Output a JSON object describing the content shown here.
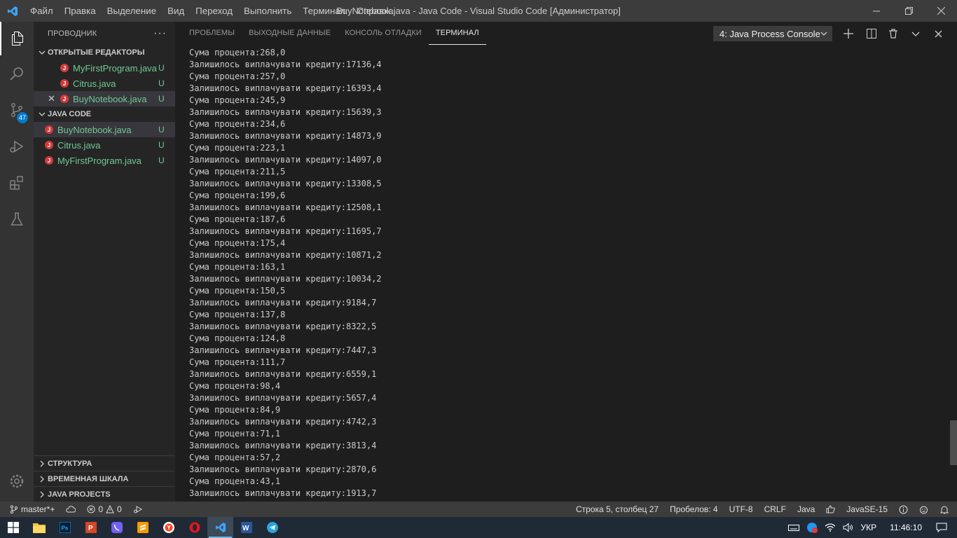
{
  "titlebar": {
    "menu": [
      "Файл",
      "Правка",
      "Выделение",
      "Вид",
      "Переход",
      "Выполнить",
      "Терминал",
      "Справка"
    ],
    "title": "BuyNotebook.java - Java Code - Visual Studio Code [Администратор]"
  },
  "activity": {
    "scm_badge": "47"
  },
  "sidebar": {
    "header": "ПРОВОДНИК",
    "more": "···",
    "open_editors": {
      "label": "ОТКРЫТЫЕ РЕДАКТОРЫ",
      "files": [
        {
          "name": "MyFirstProgram.java",
          "status": "U"
        },
        {
          "name": "Citrus.java",
          "status": "U"
        },
        {
          "name": "BuyNotebook.java",
          "status": "U",
          "close": "✕"
        }
      ]
    },
    "workspace": {
      "label": "JAVA CODE",
      "files": [
        {
          "name": "BuyNotebook.java",
          "status": "U"
        },
        {
          "name": "Citrus.java",
          "status": "U"
        },
        {
          "name": "MyFirstProgram.java",
          "status": "U"
        }
      ]
    },
    "bottom_sections": [
      "СТРУКТУРА",
      "ВРЕМЕННАЯ ШКАЛА",
      "JAVA PROJECTS"
    ]
  },
  "panel": {
    "tabs": [
      "ПРОБЛЕМЫ",
      "ВЫХОДНЫЕ ДАННЫЕ",
      "КОНСОЛЬ ОТЛАДКИ",
      "ТЕРМИНАЛ"
    ],
    "active_tab": 3,
    "terminal_select": "4: Java Process Console",
    "lines": [
      "Сума процента:268,0",
      "Залишилось виплачувати кредиту:17136,4",
      "Сума процента:257,0",
      "Залишилось виплачувати кредиту:16393,4",
      "Сума процента:245,9",
      "Залишилось виплачувати кредиту:15639,3",
      "Сума процента:234,6",
      "Залишилось виплачувати кредиту:14873,9",
      "Сума процента:223,1",
      "Залишилось виплачувати кредиту:14097,0",
      "Сума процента:211,5",
      "Залишилось виплачувати кредиту:13308,5",
      "Сума процента:199,6",
      "Залишилось виплачувати кредиту:12508,1",
      "Сума процента:187,6",
      "Залишилось виплачувати кредиту:11695,7",
      "Сума процента:175,4",
      "Залишилось виплачувати кредиту:10871,2",
      "Сума процента:163,1",
      "Залишилось виплачувати кредиту:10034,2",
      "Сума процента:150,5",
      "Залишилось виплачувати кредиту:9184,7",
      "Сума процента:137,8",
      "Залишилось виплачувати кредиту:8322,5",
      "Сума процента:124,8",
      "Залишилось виплачувати кредиту:7447,3",
      "Сума процента:111,7",
      "Залишилось виплачувати кредиту:6559,1",
      "Сума процента:98,4",
      "Залишилось виплачувати кредиту:5657,4",
      "Сума процента:84,9",
      "Залишилось виплачувати кредиту:4742,3",
      "Сума процента:71,1",
      "Залишилось виплачувати кредиту:3813,4",
      "Сума процента:57,2",
      "Залишилось виплачувати кредиту:2870,6",
      "Сума процента:43,1",
      "Залишилось виплачувати кредиту:1913,7"
    ]
  },
  "statusbar": {
    "branch": "master*+",
    "errors": "0",
    "warnings": "0",
    "position": "Строка 5, столбец 27",
    "spaces": "Пробелов: 4",
    "encoding": "UTF-8",
    "eol": "CRLF",
    "language": "Java",
    "runtime": "JavaSE-15"
  },
  "taskbar": {
    "lang": "УКР",
    "time": "11:46:10"
  },
  "colors": {
    "accent": "#007acc",
    "untracked": "#73c991",
    "java_icon": "#d33b3b"
  }
}
